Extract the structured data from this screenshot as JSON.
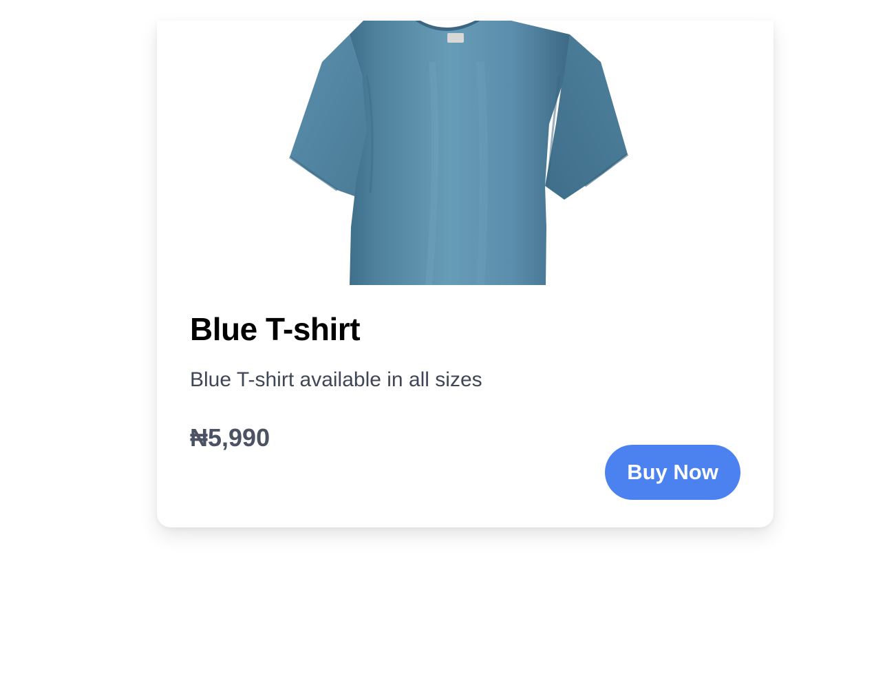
{
  "product": {
    "title": "Blue T-shirt",
    "description": "Blue T-shirt available in all sizes",
    "price": "₦5,990",
    "image_alt": "Blue T-shirt"
  },
  "actions": {
    "buy_label": "Buy Now"
  },
  "colors": {
    "shirt": "#5b8ea9",
    "button": "#4b82ef",
    "price_text": "#4b5263",
    "description_text": "#3f4656"
  }
}
